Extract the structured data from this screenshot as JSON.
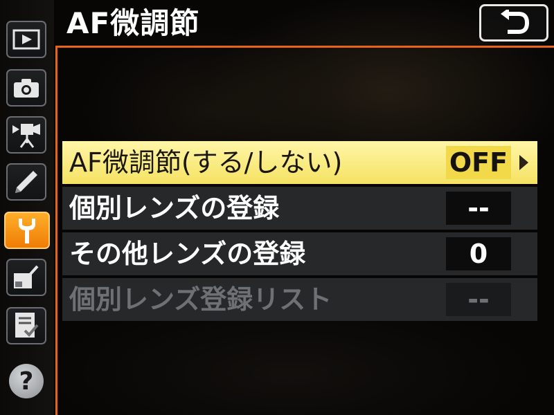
{
  "header": {
    "title": "AF微調節",
    "back_icon": "return-arrow-icon"
  },
  "sidebar": {
    "tabs": [
      {
        "name": "playback",
        "icon": "play-icon",
        "active": false
      },
      {
        "name": "photo-shooting",
        "icon": "camera-icon",
        "active": false
      },
      {
        "name": "movie-shooting",
        "icon": "movie-camera-icon",
        "active": false
      },
      {
        "name": "custom-settings",
        "icon": "pencil-icon",
        "active": false
      },
      {
        "name": "setup",
        "icon": "wrench-icon",
        "active": true
      },
      {
        "name": "retouch",
        "icon": "retouch-icon",
        "active": false
      },
      {
        "name": "my-menu",
        "icon": "my-menu-icon",
        "active": false
      }
    ],
    "help": {
      "label": "?",
      "icon": "help-icon"
    }
  },
  "menu": {
    "items": [
      {
        "label": "AF微調節(する/しない)",
        "value": "OFF",
        "state": "selected"
      },
      {
        "label": "個別レンズの登録",
        "value": "--",
        "state": "normal"
      },
      {
        "label": "その他レンズの登録",
        "value": "0",
        "state": "normal"
      },
      {
        "label": "個別レンズ登録リスト",
        "value": "--",
        "state": "disabled"
      }
    ]
  },
  "colors": {
    "accent_orange": "#e8641b",
    "active_tab": "#f28c12",
    "selected_row": "#f8ea7e"
  }
}
